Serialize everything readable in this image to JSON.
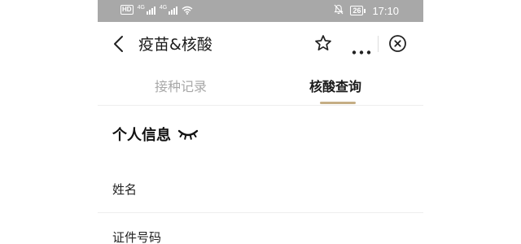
{
  "status_bar": {
    "hd_badge": "HD",
    "signal1_gen": "4G",
    "signal2_gen": "4G",
    "battery": "26",
    "time": "17:10"
  },
  "navbar": {
    "title": "疫苗&核酸"
  },
  "tabs": [
    {
      "label": "接种记录",
      "active": false
    },
    {
      "label": "核酸查询",
      "active": true
    }
  ],
  "section": {
    "title": "个人信息"
  },
  "fields": [
    {
      "label": "姓名",
      "value": ""
    },
    {
      "label": "证件号码",
      "value": ""
    }
  ],
  "colors": {
    "status_bar_bg": "#a8a8a8",
    "tab_active_underline": "#c5ae85",
    "tab_inactive_text": "#a8a8a8"
  },
  "icons": [
    "back-arrow-icon",
    "star-icon",
    "more-icon",
    "close-icon",
    "closed-eye-icon",
    "mute-icon"
  ]
}
